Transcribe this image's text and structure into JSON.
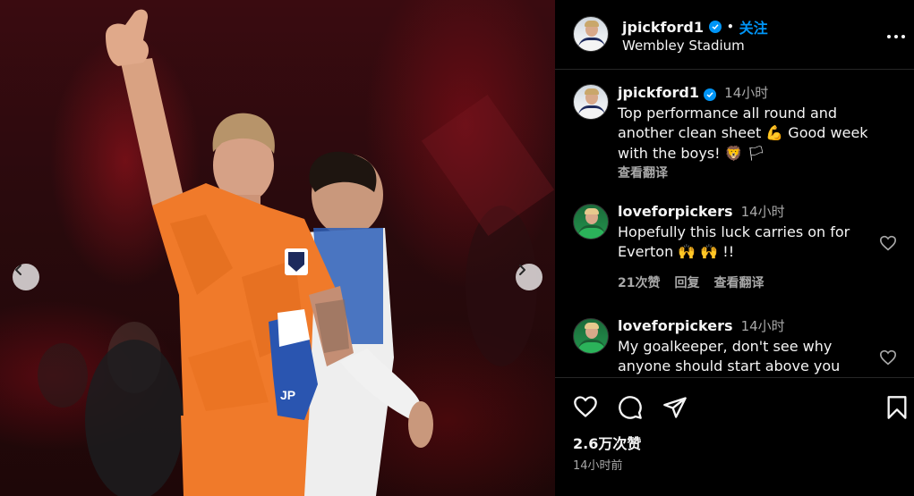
{
  "post": {
    "username": "jpickford1",
    "follow_label": "关注",
    "location": "Wembley Stadium",
    "caption": {
      "username": "jpickford1",
      "time": "14小时",
      "line1": "Top performance all round and",
      "line2": "another clean sheet 💪  Good week",
      "line3": "with the boys! 🦁 🏳",
      "translate": "查看翻译"
    },
    "comments": [
      {
        "username": "loveforpickers",
        "time": "14小时",
        "line1": "Hopefully this luck carries on for",
        "line2": "Everton 🙌 🙌 !!",
        "likes": "21次赞",
        "reply": "回复",
        "translate": "查看翻译"
      },
      {
        "username": "loveforpickers",
        "time": "14小时",
        "line1": "My goalkeeper, don't see why",
        "line2": "anyone should start above you"
      }
    ],
    "like_count": "2.6万次赞",
    "posted_time": "14小时前"
  },
  "photo": {
    "jersey_initials": "JP"
  },
  "colors": {
    "accent": "#0095f6",
    "secondary_text": "#a8a8a8",
    "kit_orange": "#f07a2a"
  },
  "icons": [
    "chevron-left-icon",
    "chevron-right-icon",
    "more-icon",
    "verified-icon",
    "heart-icon",
    "comment-icon",
    "share-icon",
    "bookmark-icon"
  ]
}
